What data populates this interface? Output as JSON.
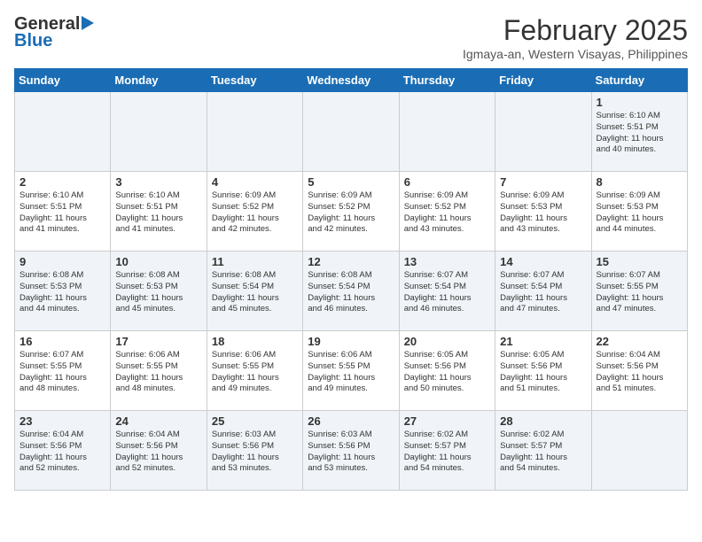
{
  "header": {
    "logo_general": "General",
    "logo_blue": "Blue",
    "month_year": "February 2025",
    "location": "Igmaya-an, Western Visayas, Philippines"
  },
  "weekdays": [
    "Sunday",
    "Monday",
    "Tuesday",
    "Wednesday",
    "Thursday",
    "Friday",
    "Saturday"
  ],
  "weeks": [
    [
      {
        "day": "",
        "info": ""
      },
      {
        "day": "",
        "info": ""
      },
      {
        "day": "",
        "info": ""
      },
      {
        "day": "",
        "info": ""
      },
      {
        "day": "",
        "info": ""
      },
      {
        "day": "",
        "info": ""
      },
      {
        "day": "1",
        "info": "Sunrise: 6:10 AM\nSunset: 5:51 PM\nDaylight: 11 hours\nand 40 minutes."
      }
    ],
    [
      {
        "day": "2",
        "info": "Sunrise: 6:10 AM\nSunset: 5:51 PM\nDaylight: 11 hours\nand 41 minutes."
      },
      {
        "day": "3",
        "info": "Sunrise: 6:10 AM\nSunset: 5:51 PM\nDaylight: 11 hours\nand 41 minutes."
      },
      {
        "day": "4",
        "info": "Sunrise: 6:09 AM\nSunset: 5:52 PM\nDaylight: 11 hours\nand 42 minutes."
      },
      {
        "day": "5",
        "info": "Sunrise: 6:09 AM\nSunset: 5:52 PM\nDaylight: 11 hours\nand 42 minutes."
      },
      {
        "day": "6",
        "info": "Sunrise: 6:09 AM\nSunset: 5:52 PM\nDaylight: 11 hours\nand 43 minutes."
      },
      {
        "day": "7",
        "info": "Sunrise: 6:09 AM\nSunset: 5:53 PM\nDaylight: 11 hours\nand 43 minutes."
      },
      {
        "day": "8",
        "info": "Sunrise: 6:09 AM\nSunset: 5:53 PM\nDaylight: 11 hours\nand 44 minutes."
      }
    ],
    [
      {
        "day": "9",
        "info": "Sunrise: 6:08 AM\nSunset: 5:53 PM\nDaylight: 11 hours\nand 44 minutes."
      },
      {
        "day": "10",
        "info": "Sunrise: 6:08 AM\nSunset: 5:53 PM\nDaylight: 11 hours\nand 45 minutes."
      },
      {
        "day": "11",
        "info": "Sunrise: 6:08 AM\nSunset: 5:54 PM\nDaylight: 11 hours\nand 45 minutes."
      },
      {
        "day": "12",
        "info": "Sunrise: 6:08 AM\nSunset: 5:54 PM\nDaylight: 11 hours\nand 46 minutes."
      },
      {
        "day": "13",
        "info": "Sunrise: 6:07 AM\nSunset: 5:54 PM\nDaylight: 11 hours\nand 46 minutes."
      },
      {
        "day": "14",
        "info": "Sunrise: 6:07 AM\nSunset: 5:54 PM\nDaylight: 11 hours\nand 47 minutes."
      },
      {
        "day": "15",
        "info": "Sunrise: 6:07 AM\nSunset: 5:55 PM\nDaylight: 11 hours\nand 47 minutes."
      }
    ],
    [
      {
        "day": "16",
        "info": "Sunrise: 6:07 AM\nSunset: 5:55 PM\nDaylight: 11 hours\nand 48 minutes."
      },
      {
        "day": "17",
        "info": "Sunrise: 6:06 AM\nSunset: 5:55 PM\nDaylight: 11 hours\nand 48 minutes."
      },
      {
        "day": "18",
        "info": "Sunrise: 6:06 AM\nSunset: 5:55 PM\nDaylight: 11 hours\nand 49 minutes."
      },
      {
        "day": "19",
        "info": "Sunrise: 6:06 AM\nSunset: 5:55 PM\nDaylight: 11 hours\nand 49 minutes."
      },
      {
        "day": "20",
        "info": "Sunrise: 6:05 AM\nSunset: 5:56 PM\nDaylight: 11 hours\nand 50 minutes."
      },
      {
        "day": "21",
        "info": "Sunrise: 6:05 AM\nSunset: 5:56 PM\nDaylight: 11 hours\nand 51 minutes."
      },
      {
        "day": "22",
        "info": "Sunrise: 6:04 AM\nSunset: 5:56 PM\nDaylight: 11 hours\nand 51 minutes."
      }
    ],
    [
      {
        "day": "23",
        "info": "Sunrise: 6:04 AM\nSunset: 5:56 PM\nDaylight: 11 hours\nand 52 minutes."
      },
      {
        "day": "24",
        "info": "Sunrise: 6:04 AM\nSunset: 5:56 PM\nDaylight: 11 hours\nand 52 minutes."
      },
      {
        "day": "25",
        "info": "Sunrise: 6:03 AM\nSunset: 5:56 PM\nDaylight: 11 hours\nand 53 minutes."
      },
      {
        "day": "26",
        "info": "Sunrise: 6:03 AM\nSunset: 5:56 PM\nDaylight: 11 hours\nand 53 minutes."
      },
      {
        "day": "27",
        "info": "Sunrise: 6:02 AM\nSunset: 5:57 PM\nDaylight: 11 hours\nand 54 minutes."
      },
      {
        "day": "28",
        "info": "Sunrise: 6:02 AM\nSunset: 5:57 PM\nDaylight: 11 hours\nand 54 minutes."
      },
      {
        "day": "",
        "info": ""
      }
    ]
  ]
}
